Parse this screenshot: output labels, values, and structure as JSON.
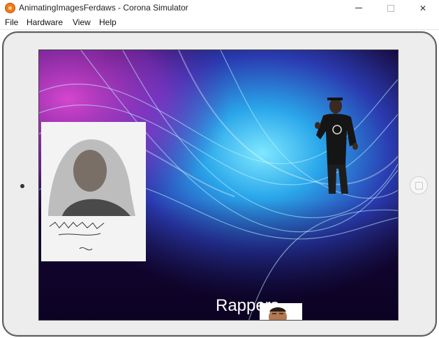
{
  "window": {
    "title": "AnimatingImagesFerdaws - Corona Simulator",
    "icon": "corona-sdk-logo-icon",
    "controls": {
      "minimize_icon": "minimize-icon",
      "maximize_icon": "maximize-icon",
      "close_glyph": "✕"
    }
  },
  "menu": {
    "items": [
      "File",
      "Hardware",
      "View",
      "Help"
    ]
  },
  "simulator": {
    "device": "ipad-landscape",
    "screen": {
      "caption": "Rappers",
      "images": [
        "portrait-sketch-image",
        "dancing-figure-image",
        "small-portrait-image"
      ]
    }
  },
  "colors": {
    "wallpaper_top_left": "#c43fd0",
    "wallpaper_center": "#2ba6e8",
    "wallpaper_bottom": "#12052e",
    "device_frame": "#ededed"
  }
}
